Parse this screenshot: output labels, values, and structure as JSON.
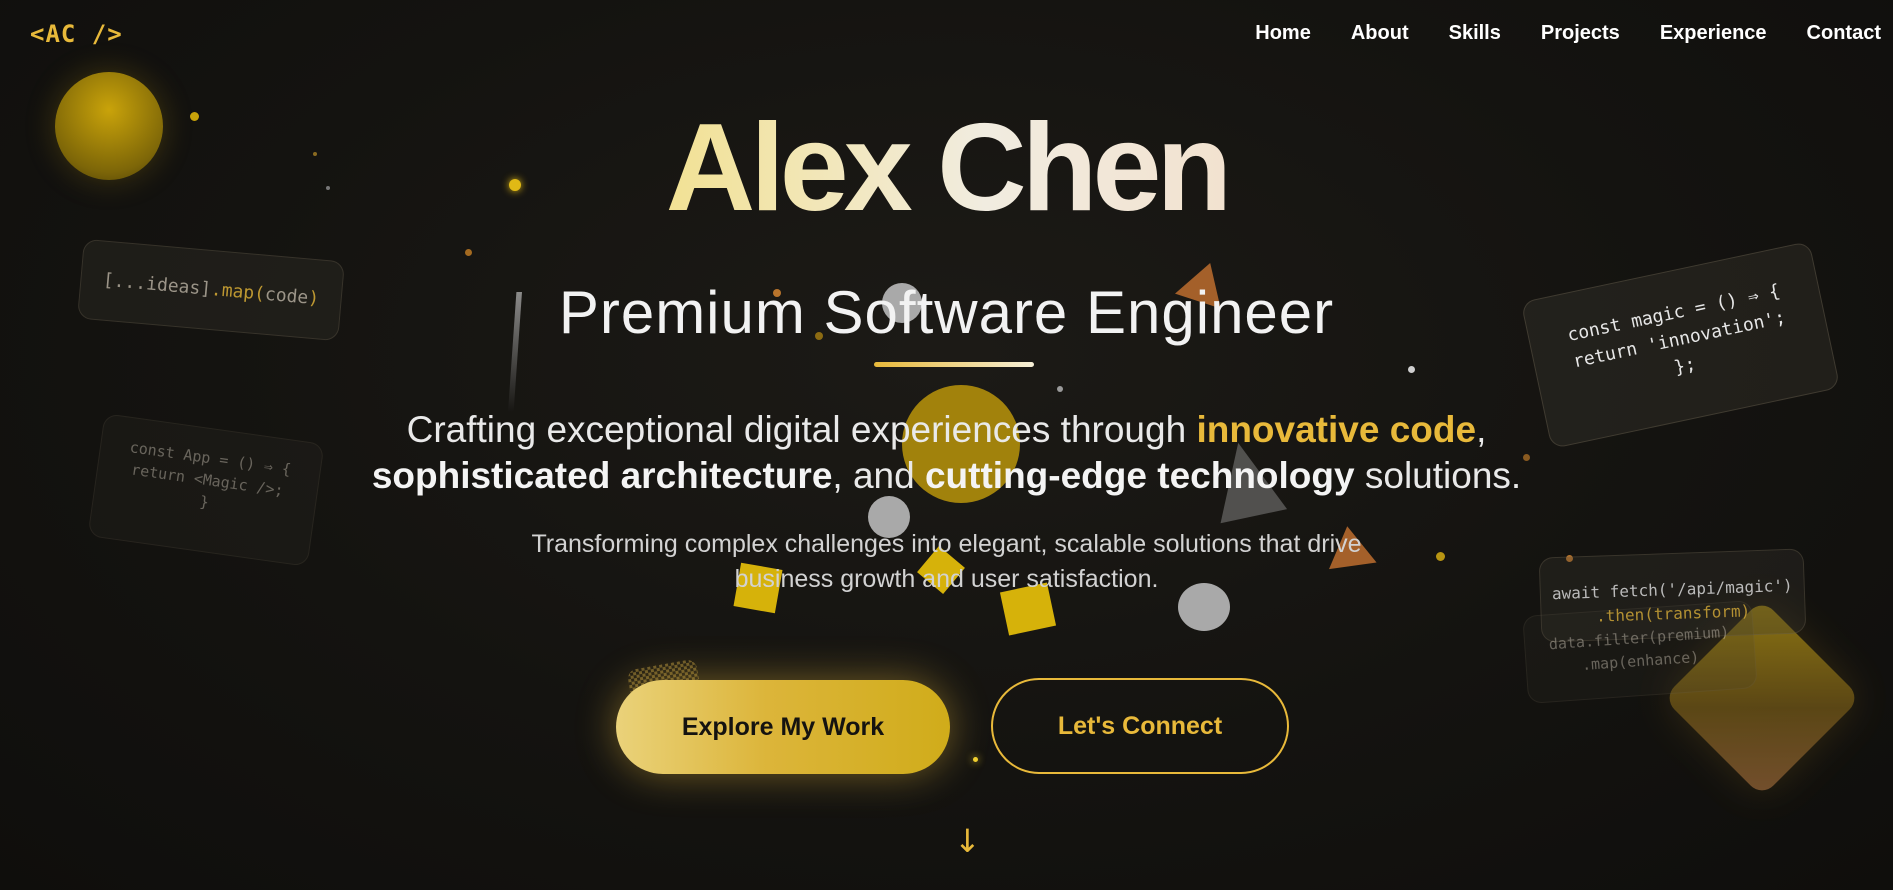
{
  "brand": {
    "logo": "<AC />"
  },
  "nav": [
    {
      "label": "Home"
    },
    {
      "label": "About"
    },
    {
      "label": "Skills"
    },
    {
      "label": "Projects"
    },
    {
      "label": "Experience"
    },
    {
      "label": "Contact"
    }
  ],
  "hero": {
    "name": "Alex Chen",
    "role": "Premium Software Engineer",
    "tagline": {
      "part1": "Crafting exceptional digital experiences through ",
      "highlight": "innovative code",
      "part2": ",",
      "strong1": "sophisticated architecture",
      "part3": ", and ",
      "strong2": "cutting-edge technology",
      "part4": " solutions."
    },
    "sub": {
      "line1": "Transforming complex challenges into elegant, scalable solutions that drive",
      "line2": "business growth and user satisfaction."
    },
    "primary_cta": "Explore My Work",
    "secondary_cta": "Let's Connect",
    "scroll_icon": "↓"
  },
  "code_cards": {
    "ideas": {
      "pre": "[...ideas]",
      "fn": ".map(",
      "arg": "code",
      "close": ")"
    },
    "app": {
      "line1": "const App = () ⇒ {",
      "line2": "return <Magic />;",
      "line3": "}"
    },
    "magic": {
      "line1": "const magic = () ⇒ {",
      "line2": "return 'innovation';",
      "line3": "};"
    },
    "fetch": {
      "line1": "await fetch('/api/magic')",
      "line2": ".then(transform)"
    },
    "filter": {
      "line1": "data.filter(premium)",
      "line2": ".map(enhance)"
    }
  },
  "colors": {
    "accent": "#e8b93a",
    "background": "#141310",
    "text": "#f2f2f2"
  }
}
